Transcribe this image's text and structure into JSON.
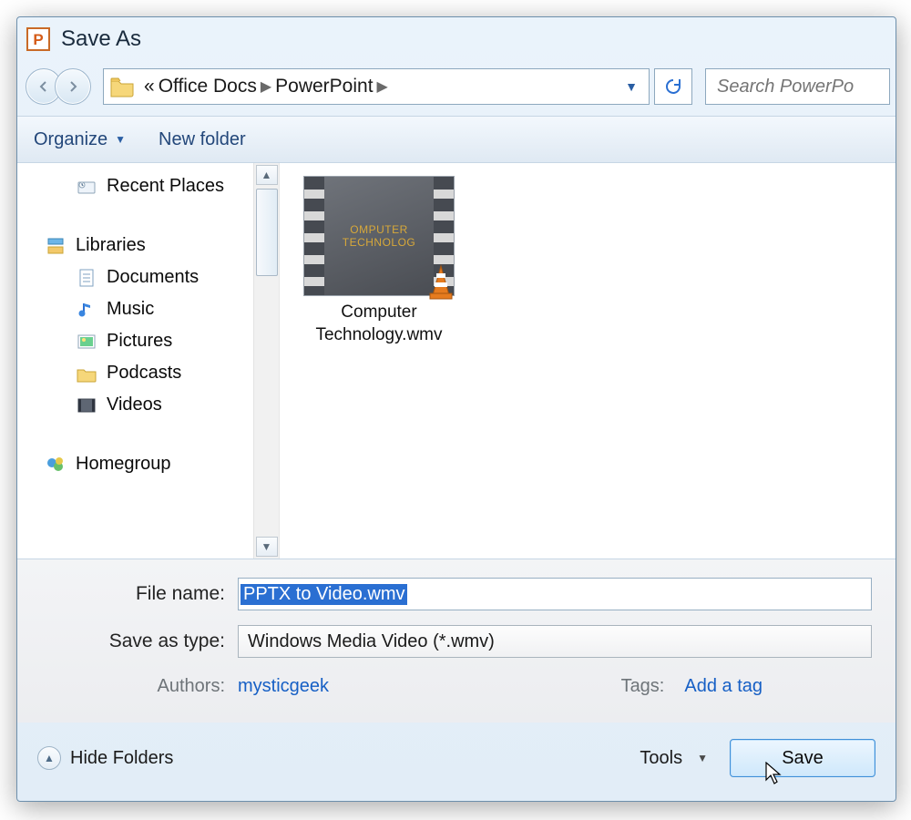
{
  "title": "Save As",
  "breadcrumb": {
    "prefix": "«",
    "seg1": "Office Docs",
    "seg2": "PowerPoint"
  },
  "search": {
    "placeholder": "Search PowerPo"
  },
  "cmdbar": {
    "organize": "Organize",
    "newfolder": "New folder"
  },
  "sidebar": {
    "recent": "Recent Places",
    "libraries": "Libraries",
    "documents": "Documents",
    "music": "Music",
    "pictures": "Pictures",
    "podcasts": "Podcasts",
    "videos": "Videos",
    "homegroup": "Homegroup"
  },
  "file": {
    "label_line1": "Computer",
    "label_line2": "Technology.wmv",
    "thumb_text": "OMPUTER TECHNOLOG"
  },
  "fields": {
    "filename_label": "File name:",
    "filename_value": "PPTX to Video.wmv",
    "type_label": "Save as type:",
    "type_value": "Windows Media Video (*.wmv)",
    "authors_label": "Authors:",
    "authors_value": "mysticgeek",
    "tags_label": "Tags:",
    "tags_value": "Add a tag"
  },
  "footer": {
    "hidefolders": "Hide Folders",
    "tools": "Tools",
    "save": "Save"
  }
}
